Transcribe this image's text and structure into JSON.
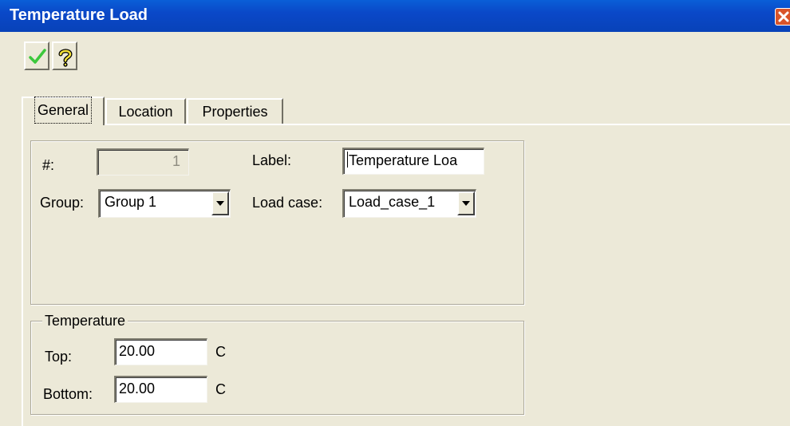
{
  "window": {
    "title": "Temperature Load"
  },
  "toolbar": {
    "ok_icon": "checkmark-icon",
    "help_icon": "question-mark-icon"
  },
  "tabs": [
    {
      "label": "General"
    },
    {
      "label": "Location"
    },
    {
      "label": "Properties"
    }
  ],
  "general": {
    "number_label": "#:",
    "number_value": "1",
    "label_label": "Label:",
    "label_value": "Temperature Loa",
    "group_label": "Group:",
    "group_value": "Group 1",
    "loadcase_label": "Load case:",
    "loadcase_value": "Load_case_1"
  },
  "temperature": {
    "legend": "Temperature",
    "top_label": "Top:",
    "top_value": "20.00",
    "top_unit": "C",
    "bottom_label": "Bottom:",
    "bottom_value": "20.00",
    "bottom_unit": "C"
  },
  "colors": {
    "titlebar": "#0a48c8",
    "dialog_bg": "#ece9d8",
    "close": "#d9542a",
    "check": "#3cc83c"
  }
}
